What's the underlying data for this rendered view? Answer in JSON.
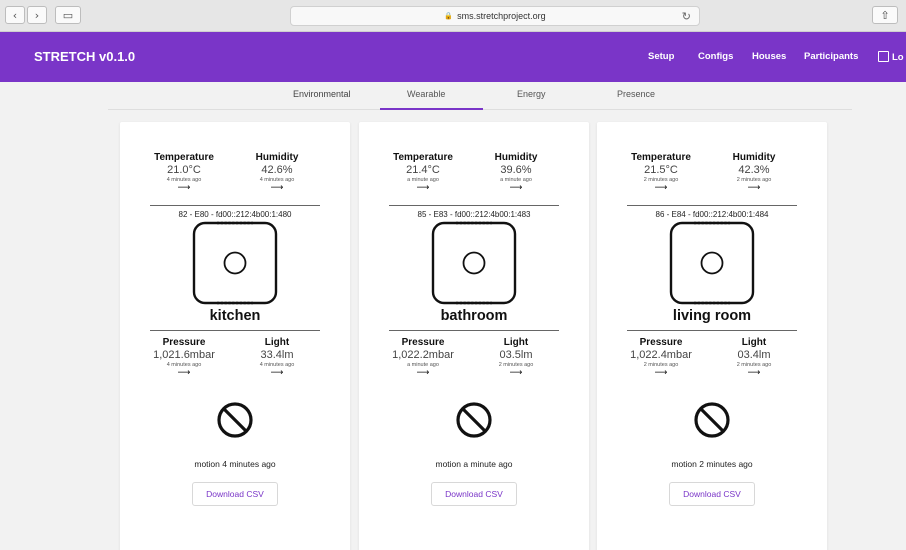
{
  "browser": {
    "url": "sms.stretchproject.org",
    "back_glyph": "‹",
    "forward_glyph": "›",
    "tabs_glyph": "▭",
    "lock_glyph": "🔒",
    "reload_glyph": "↻",
    "share_glyph": "⇧"
  },
  "header": {
    "brand": "STRETCH v0.1.0",
    "nav": [
      "Setup",
      "Configs",
      "Houses",
      "Participants",
      "Lo"
    ],
    "color": "#7a35c8"
  },
  "subtabs": [
    "Environmental",
    "Wearable",
    "Energy",
    "Presence"
  ],
  "arrow_glyph": "⟶",
  "cards": [
    {
      "temperature": {
        "label": "Temperature",
        "value": "21.0°C",
        "ago": "4 minutes ago"
      },
      "humidity": {
        "label": "Humidity",
        "value": "42.6%",
        "ago": "4 minutes ago"
      },
      "device": "82 - E80 - fd00::212:4b00:1:480",
      "room": "kitchen",
      "pressure": {
        "label": "Pressure",
        "value": "1,021.6mbar",
        "ago": "4 minutes ago"
      },
      "light": {
        "label": "Light",
        "value": "33.4lm",
        "ago": "4 minutes ago"
      },
      "motion": "motion 4 minutes ago",
      "download": "Download CSV"
    },
    {
      "temperature": {
        "label": "Temperature",
        "value": "21.4°C",
        "ago": "a minute ago"
      },
      "humidity": {
        "label": "Humidity",
        "value": "39.6%",
        "ago": "a minute ago"
      },
      "device": "85 - E83 - fd00::212:4b00:1:483",
      "room": "bathroom",
      "pressure": {
        "label": "Pressure",
        "value": "1,022.2mbar",
        "ago": "a minute ago"
      },
      "light": {
        "label": "Light",
        "value": "03.5lm",
        "ago": "2 minutes ago"
      },
      "motion": "motion a minute ago",
      "download": "Download CSV"
    },
    {
      "temperature": {
        "label": "Temperature",
        "value": "21.5°C",
        "ago": "2 minutes ago"
      },
      "humidity": {
        "label": "Humidity",
        "value": "42.3%",
        "ago": "2 minutes ago"
      },
      "device": "86 - E84 - fd00::212:4b00:1:484",
      "room": "living room",
      "pressure": {
        "label": "Pressure",
        "value": "1,022.4mbar",
        "ago": "2 minutes ago"
      },
      "light": {
        "label": "Light",
        "value": "03.4lm",
        "ago": "2 minutes ago"
      },
      "motion": "motion 2 minutes ago",
      "download": "Download CSV"
    }
  ]
}
